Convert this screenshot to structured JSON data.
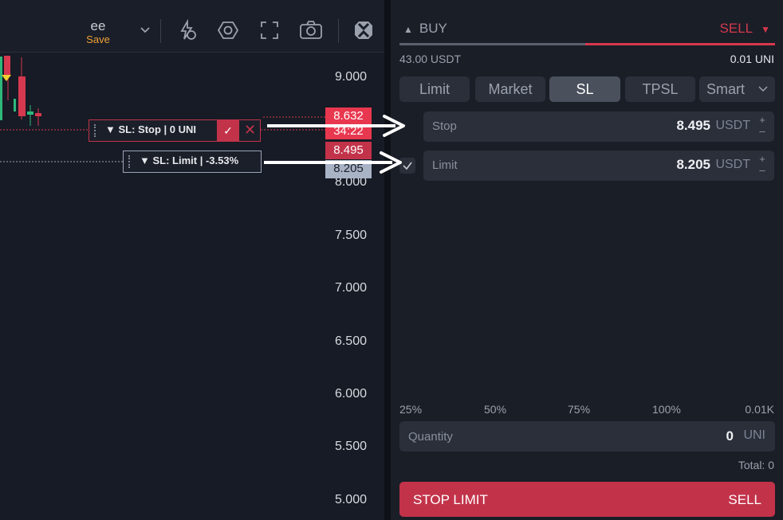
{
  "toolbar": {
    "layout_name": "ee",
    "save_label": "Save"
  },
  "price_axis": {
    "labels": [
      "9.000",
      "8.000",
      "7.500",
      "7.000",
      "6.500",
      "6.000",
      "5.500",
      "5.000"
    ],
    "current_price": "8.632",
    "countdown": "34:22",
    "stop_tag": "8.495",
    "limit_tag": "8.205"
  },
  "chart_orders": {
    "stop_label": "▼ SL: Stop | 0 UNI",
    "limit_label": "▼ SL: Limit | -3.53%",
    "confirm_icon": "check-icon",
    "cancel_icon": "close-icon"
  },
  "order_panel": {
    "buy_label": "BUY",
    "sell_label": "SELL",
    "available_quote": "43.00 USDT",
    "available_base": "0.01 UNI",
    "tabs": [
      {
        "label": "Limit",
        "active": false
      },
      {
        "label": "Market",
        "active": false
      },
      {
        "label": "SL",
        "active": true
      },
      {
        "label": "TPSL",
        "active": false
      },
      {
        "label": "Smart",
        "active": false
      }
    ],
    "stop_field": {
      "label": "Stop",
      "value": "8.495",
      "unit": "USDT"
    },
    "limit_field": {
      "label": "Limit",
      "value": "8.205",
      "unit": "USDT",
      "enabled": true
    },
    "percent_options": [
      "25%",
      "50%",
      "75%",
      "100%",
      "0.01K"
    ],
    "quantity_field": {
      "placeholder": "Quantity",
      "value": "0",
      "unit": "UNI"
    },
    "total": "Total: 0",
    "submit_left": "STOP LIMIT",
    "submit_right": "SELL"
  },
  "colors": {
    "sell": "#d6384f",
    "accent_warning": "#f0a038",
    "panel_bg": "#1a1e27",
    "field_bg": "#2a2f3a"
  }
}
